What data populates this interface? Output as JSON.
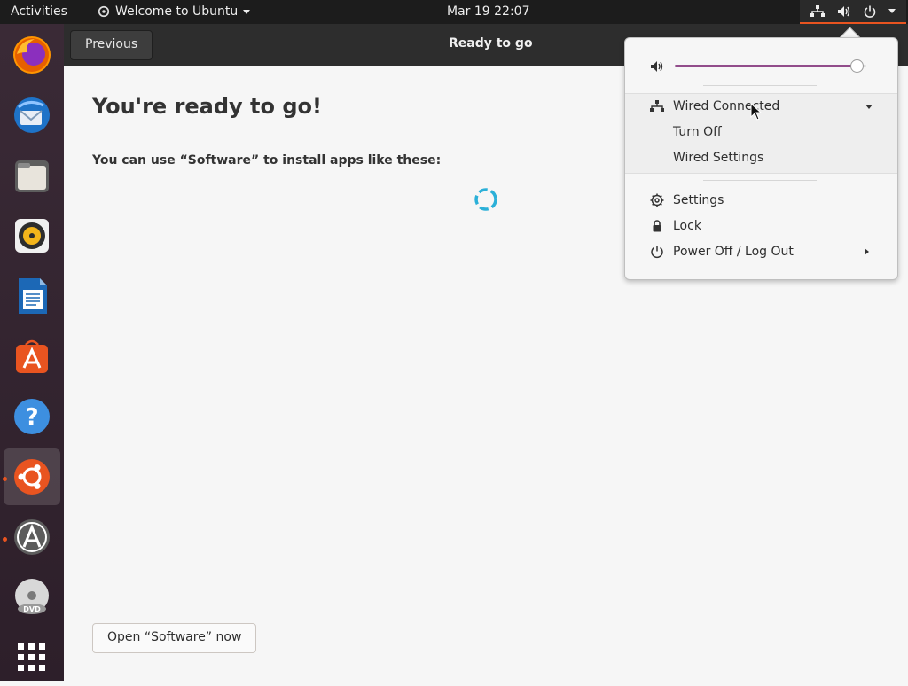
{
  "topbar": {
    "activities": "Activities",
    "app_name": "Welcome to Ubuntu",
    "clock": "Mar 19  22:07"
  },
  "dock": {
    "items": [
      {
        "name": "firefox"
      },
      {
        "name": "thunderbird"
      },
      {
        "name": "files"
      },
      {
        "name": "rhythmbox"
      },
      {
        "name": "libreoffice-writer"
      },
      {
        "name": "ubuntu-software"
      },
      {
        "name": "help"
      },
      {
        "name": "ubuntu-installer"
      },
      {
        "name": "software-updater"
      },
      {
        "name": "dvd"
      },
      {
        "name": "show-applications"
      }
    ]
  },
  "window": {
    "previous_label": "Previous",
    "title": "Ready to go",
    "heading": "You're ready to go!",
    "subheading": "You can use “Software” to install apps like these:",
    "open_software_label": "Open “Software” now"
  },
  "system_menu": {
    "volume_level": 0.95,
    "wired_label": "Wired Connected",
    "turn_off_label": "Turn Off",
    "wired_settings_label": "Wired Settings",
    "settings_label": "Settings",
    "lock_label": "Lock",
    "power_label": "Power Off / Log Out"
  },
  "colors": {
    "accent": "#e95420",
    "slider_fill": "#924d8b",
    "spinner": "#2bb0d8"
  }
}
